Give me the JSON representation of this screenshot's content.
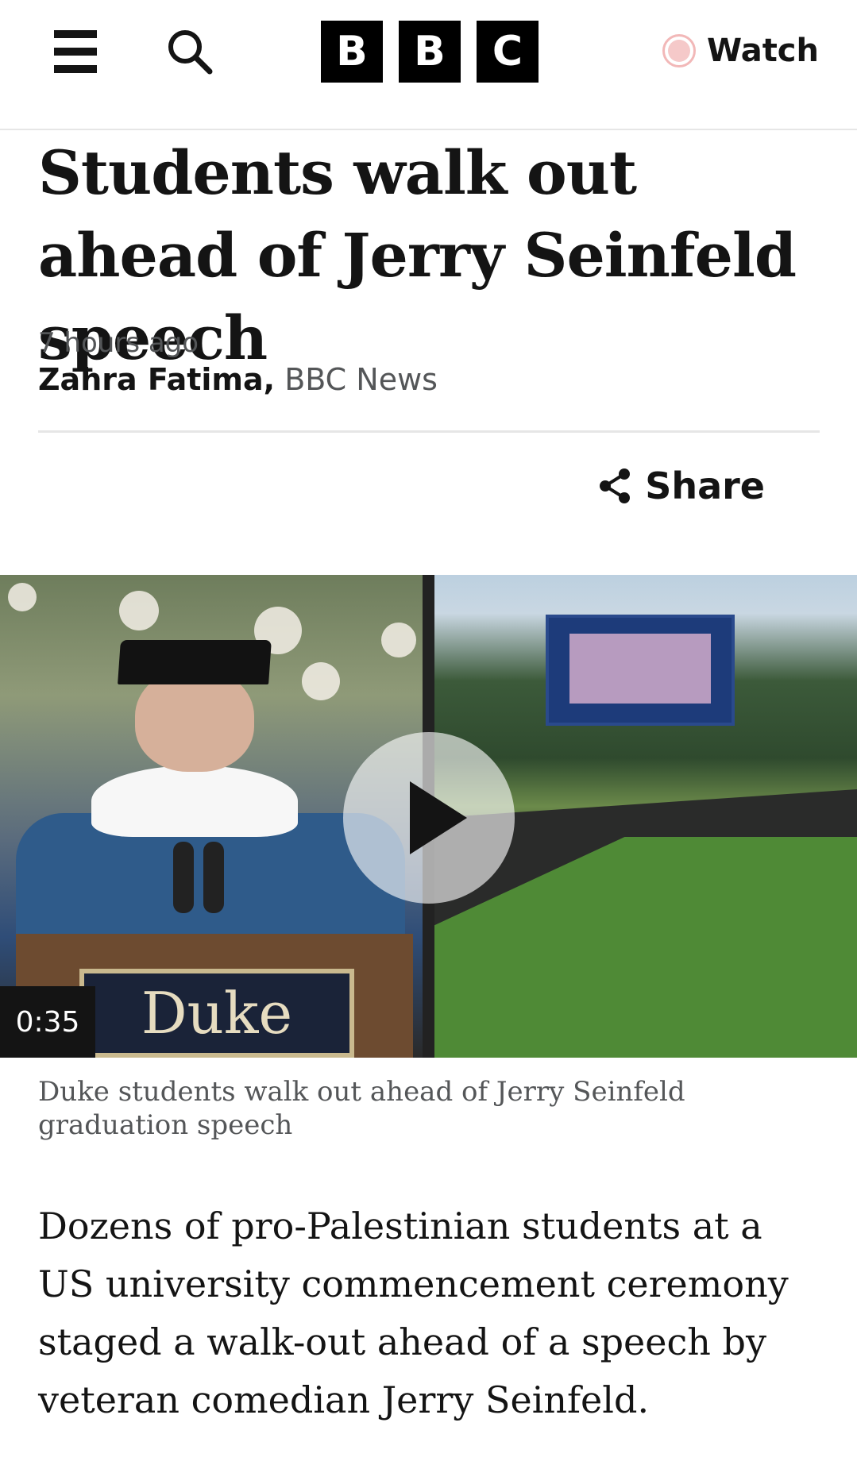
{
  "header": {
    "logo_letters": [
      "B",
      "B",
      "C"
    ],
    "watch_label": "Watch",
    "icons": [
      "menu-icon",
      "search-icon",
      "live-dot-icon"
    ]
  },
  "article": {
    "headline": "Students walk out ahead of Jerry Seinfeld speech",
    "time": "7 hours ago",
    "author": "Zahra Fatima,",
    "organization": "BBC News",
    "share_label": "Share",
    "media": {
      "duration": "0:35",
      "podium_text": "Duke",
      "caption": "Duke students walk out ahead of Jerry Seinfeld graduation speech"
    },
    "body": "Dozens of pro-Palestinian students at a US university commencement ceremony staged a walk-out ahead of a speech by veteran comedian Jerry Seinfeld."
  },
  "colors": {
    "text": "#141414",
    "meta": "#545658",
    "divider": "#e6e6e6",
    "logo_bg": "#000000",
    "live_dot": "#f5c9c9"
  }
}
